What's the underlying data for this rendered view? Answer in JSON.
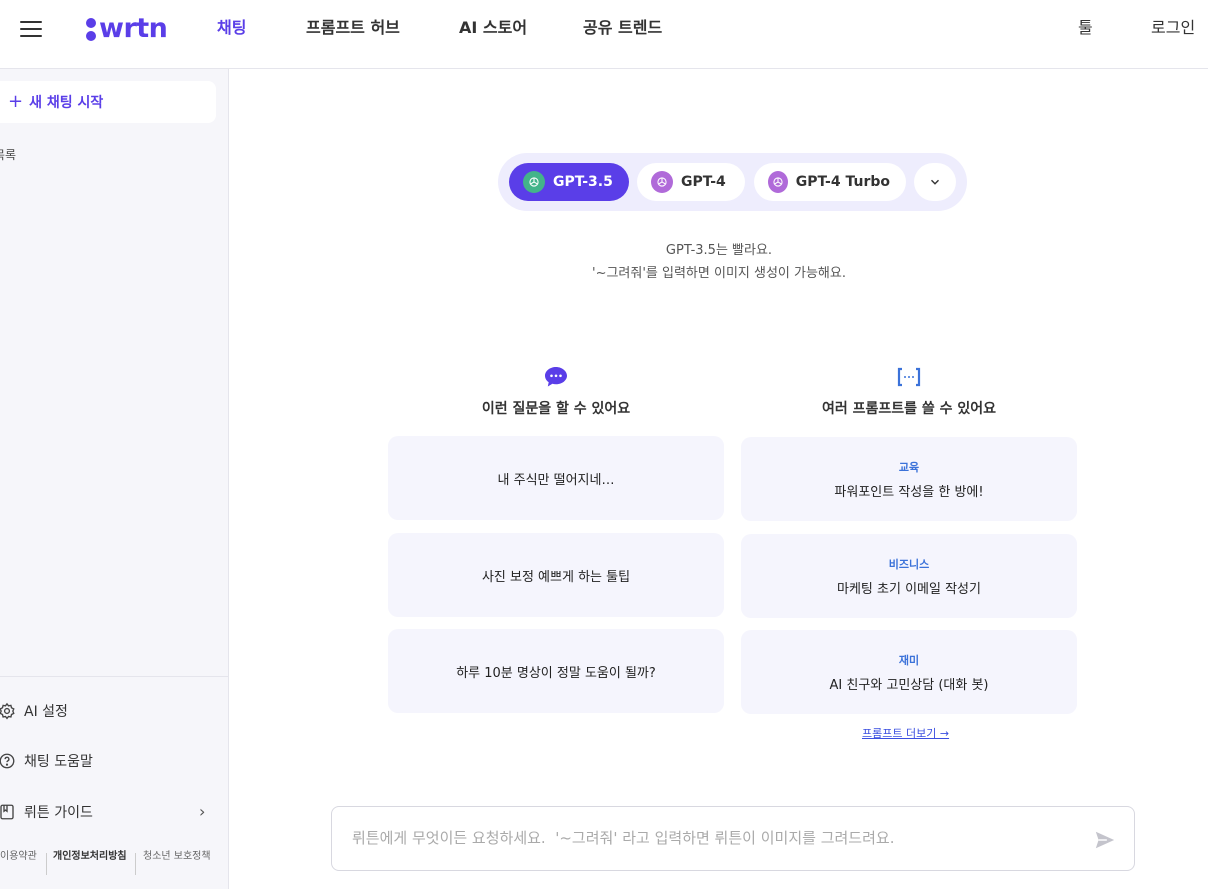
{
  "header": {
    "logo": "wrtn",
    "nav": [
      "채팅",
      "프롬프트 허브",
      "AI 스토어",
      "공유 트렌드"
    ],
    "tools": "툴",
    "login": "로그인"
  },
  "sidebar": {
    "new_chat": "새 채팅 시작",
    "list_label": "목록",
    "items": [
      {
        "label": "AI 설정",
        "icon": "gear-icon"
      },
      {
        "label": "채팅 도움말",
        "icon": "help-circle-icon"
      },
      {
        "label": "뤼튼 가이드",
        "icon": "book-icon"
      }
    ],
    "footer": [
      "이용약관",
      "개인정보처리방침",
      "청소년 보호정책"
    ]
  },
  "models": {
    "options": [
      "GPT-3.5",
      "GPT-4",
      "GPT-4 Turbo"
    ],
    "selected": "GPT-3.5"
  },
  "description": {
    "line1": "GPT-3.5는 빨라요.",
    "line2": "'~그려줘'를 입력하면 이미지 생성이 가능해요."
  },
  "questions": {
    "title": "이런 질문을 할 수 있어요",
    "items": [
      "내 주식만 떨어지네…",
      "사진 보정 예쁘게 하는 툴팁",
      "하루 10분 명상이 정말 도움이 될까?"
    ]
  },
  "prompts": {
    "title": "여러 프롬프트를 쓸 수 있어요",
    "items": [
      {
        "category": "교육",
        "text": "파워포인트 작성을 한 방에!"
      },
      {
        "category": "비즈니스",
        "text": "마케팅 초기 이메일 작성기"
      },
      {
        "category": "재미",
        "text": "AI 친구와 고민상담 (대화 봇)"
      }
    ],
    "more": "프롬프트 더보기 →"
  },
  "chat_input": {
    "placeholder": "뤼튼에게 무엇이든 요청하세요.  '~그려줘' 라고 입력하면 뤼튼이 이미지를 그려드려요."
  },
  "colors": {
    "brand": "#5a3ee8",
    "accent_blue": "#3b72d9",
    "card_bg": "#f5f5fd"
  }
}
